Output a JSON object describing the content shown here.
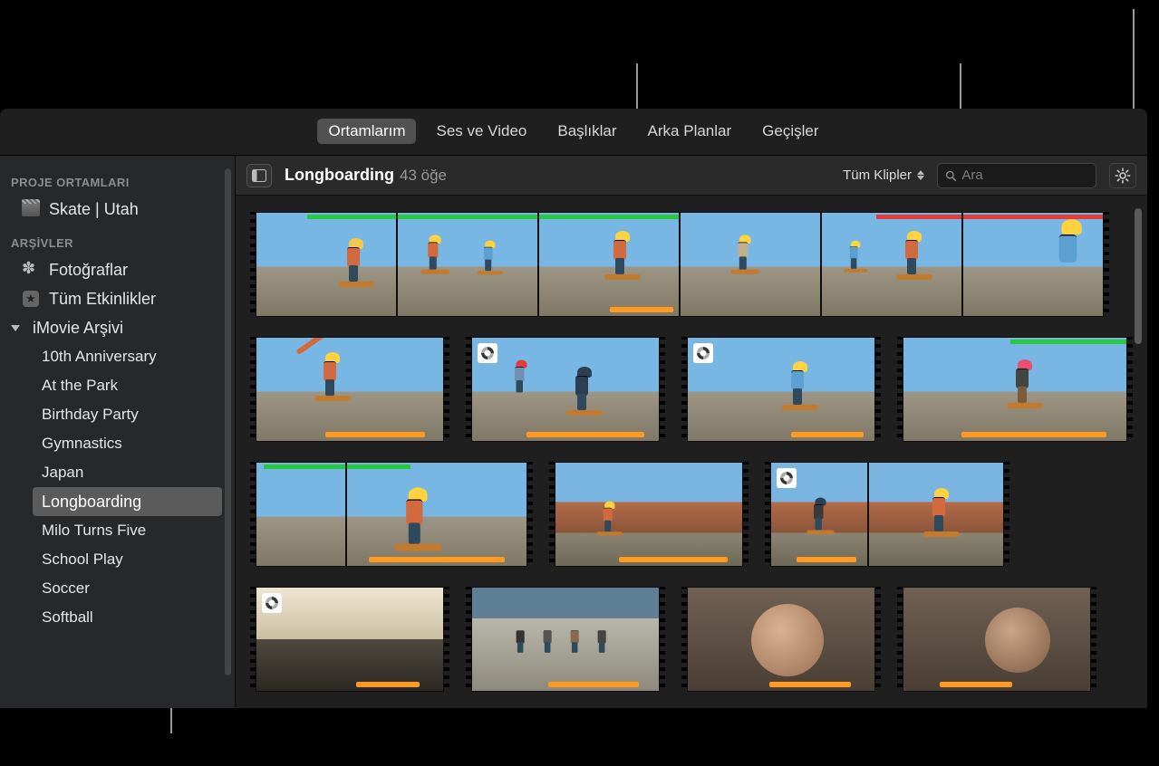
{
  "tabs": {
    "my_media": "Ortamlarım",
    "audio_video": "Ses ve Video",
    "titles": "Başlıklar",
    "backgrounds": "Arka Planlar",
    "transitions": "Geçişler",
    "active": "my_media"
  },
  "sidebar": {
    "project_media_label": "PROJE ORTAMLARI",
    "project_item": "Skate | Utah",
    "libraries_label": "ARŞİVLER",
    "photos": "Fotoğraflar",
    "all_events": "Tüm Etkinlikler",
    "archive_root": "iMovie Arşivi",
    "events": [
      "10th Anniversary",
      "At the Park",
      "Birthday Party",
      "Gymnastics",
      "Japan",
      "Longboarding",
      "Milo Turns Five",
      "School Play",
      "Soccer",
      "Softball"
    ],
    "selected_event": "Longboarding"
  },
  "browser": {
    "title": "Longboarding",
    "count_text": "43 öğe",
    "filter_label": "Tüm Klipler",
    "search_placeholder": "Ara"
  },
  "icons": {
    "panel": "panel-toggle-icon",
    "search": "search-icon",
    "gear": "gear-icon",
    "slate": "clapperboard-icon",
    "flower": "photos-icon",
    "star": "all-events-icon",
    "updown": "popup-arrows-icon"
  }
}
